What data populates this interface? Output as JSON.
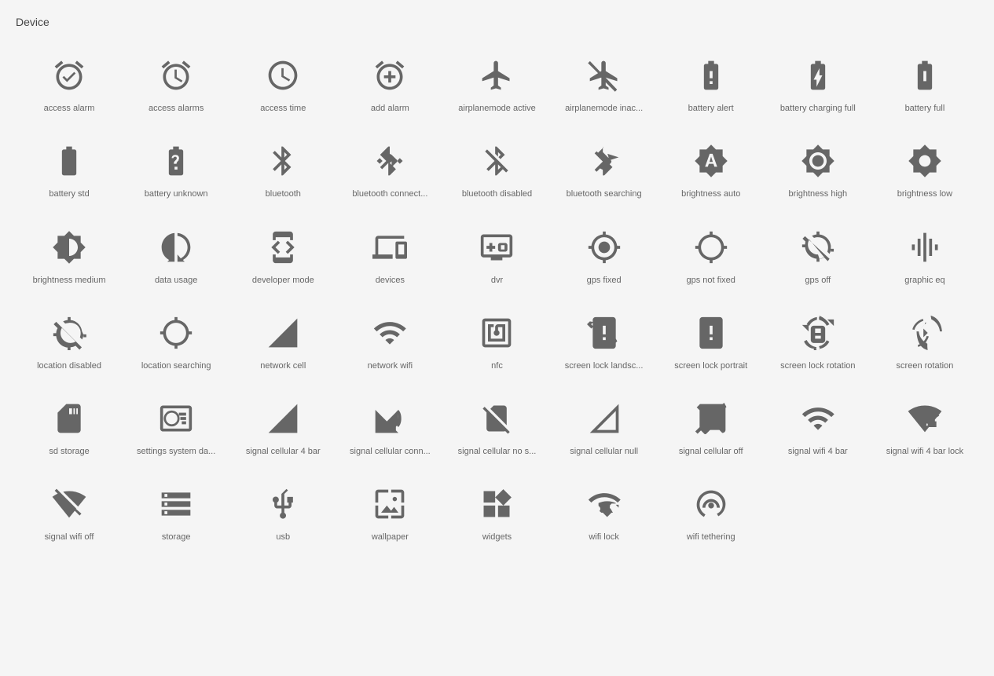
{
  "title": "Device",
  "icons": [
    {
      "name": "access-alarm-icon",
      "label": "access alarm",
      "svg": "alarm1"
    },
    {
      "name": "access-alarms-icon",
      "label": "access alarms",
      "svg": "alarm2"
    },
    {
      "name": "access-time-icon",
      "label": "access time",
      "svg": "clock"
    },
    {
      "name": "add-alarm-icon",
      "label": "add alarm",
      "svg": "addalarm"
    },
    {
      "name": "airplanemode-active-icon",
      "label": "airplanemode active",
      "svg": "airplane"
    },
    {
      "name": "airplanemode-inactive-icon",
      "label": "airplanemode inac...",
      "svg": "airplaneoff"
    },
    {
      "name": "battery-alert-icon",
      "label": "battery alert",
      "svg": "batteryalert"
    },
    {
      "name": "battery-charging-full-icon",
      "label": "battery charging full",
      "svg": "batterychargingfull"
    },
    {
      "name": "battery-full-icon",
      "label": "battery full",
      "svg": "batteryfull"
    },
    {
      "name": "battery-std-icon",
      "label": "battery std",
      "svg": "batterystd"
    },
    {
      "name": "battery-unknown-icon",
      "label": "battery unknown",
      "svg": "batteryunknown"
    },
    {
      "name": "bluetooth-icon",
      "label": "bluetooth",
      "svg": "bluetooth"
    },
    {
      "name": "bluetooth-connected-icon",
      "label": "bluetooth connect...",
      "svg": "bluetoothconnected"
    },
    {
      "name": "bluetooth-disabled-icon",
      "label": "bluetooth disabled",
      "svg": "bluetoothdisabled"
    },
    {
      "name": "bluetooth-searching-icon",
      "label": "bluetooth searching",
      "svg": "bluetoothsearching"
    },
    {
      "name": "brightness-auto-icon",
      "label": "brightness auto",
      "svg": "brightnessauto"
    },
    {
      "name": "brightness-high-icon",
      "label": "brightness high",
      "svg": "brightnesshigh"
    },
    {
      "name": "brightness-low-icon",
      "label": "brightness low",
      "svg": "brightnesslow"
    },
    {
      "name": "brightness-medium-icon",
      "label": "brightness medium",
      "svg": "brightnessmedium"
    },
    {
      "name": "data-usage-icon",
      "label": "data usage",
      "svg": "datausage"
    },
    {
      "name": "developer-mode-icon",
      "label": "developer mode",
      "svg": "developermode"
    },
    {
      "name": "devices-icon",
      "label": "devices",
      "svg": "devices"
    },
    {
      "name": "dvr-icon",
      "label": "dvr",
      "svg": "dvr"
    },
    {
      "name": "gps-fixed-icon",
      "label": "gps fixed",
      "svg": "gpsfixed"
    },
    {
      "name": "gps-not-fixed-icon",
      "label": "gps not fixed",
      "svg": "gpsnotfixed"
    },
    {
      "name": "gps-off-icon",
      "label": "gps off",
      "svg": "gpsoff"
    },
    {
      "name": "graphic-eq-icon",
      "label": "graphic eq",
      "svg": "graphiceq"
    },
    {
      "name": "location-disabled-icon",
      "label": "location disabled",
      "svg": "locationdisabled"
    },
    {
      "name": "location-searching-icon",
      "label": "location searching",
      "svg": "locationsearching"
    },
    {
      "name": "network-cell-icon",
      "label": "network cell",
      "svg": "networkcell"
    },
    {
      "name": "network-wifi-icon",
      "label": "network wifi",
      "svg": "networkwifi"
    },
    {
      "name": "nfc-icon",
      "label": "nfc",
      "svg": "nfc"
    },
    {
      "name": "screen-lock-landscape-icon",
      "label": "screen lock landsc...",
      "svg": "screenlocklandscape"
    },
    {
      "name": "screen-lock-portrait-icon",
      "label": "screen lock portrait",
      "svg": "screenlockportrait"
    },
    {
      "name": "screen-lock-rotation-icon",
      "label": "screen lock rotation",
      "svg": "screenlockrotation"
    },
    {
      "name": "screen-rotation-icon",
      "label": "screen rotation",
      "svg": "screenrotation"
    },
    {
      "name": "sd-storage-icon",
      "label": "sd storage",
      "svg": "sdstorage"
    },
    {
      "name": "settings-system-daydream-icon",
      "label": "settings system da...",
      "svg": "settingssystem"
    },
    {
      "name": "signal-cellular-4bar-icon",
      "label": "signal cellular 4 bar",
      "svg": "signalcellular4bar"
    },
    {
      "name": "signal-cellular-connected-icon",
      "label": "signal cellular conn...",
      "svg": "signalcellularconnected"
    },
    {
      "name": "signal-cellular-no-sim-icon",
      "label": "signal cellular no s...",
      "svg": "signalcellularnosim"
    },
    {
      "name": "signal-cellular-null-icon",
      "label": "signal cellular null",
      "svg": "signalcellularnull"
    },
    {
      "name": "signal-cellular-off-icon",
      "label": "signal cellular off",
      "svg": "signalcellularoff"
    },
    {
      "name": "signal-wifi-4bar-icon",
      "label": "signal wifi 4 bar",
      "svg": "signalwifi4bar"
    },
    {
      "name": "signal-wifi-4bar-lock-icon",
      "label": "signal wifi 4 bar lock",
      "svg": "signalwifi4barlock"
    },
    {
      "name": "signal-wifi-off-icon",
      "label": "signal wifi off",
      "svg": "signalwifioff"
    },
    {
      "name": "storage-icon",
      "label": "storage",
      "svg": "storage"
    },
    {
      "name": "usb-icon",
      "label": "usb",
      "svg": "usb"
    },
    {
      "name": "wallpaper-icon",
      "label": "wallpaper",
      "svg": "wallpaper"
    },
    {
      "name": "widgets-icon",
      "label": "widgets",
      "svg": "widgets"
    },
    {
      "name": "wifi-lock-icon",
      "label": "wifi lock",
      "svg": "wifilock"
    },
    {
      "name": "wifi-tethering-icon",
      "label": "wifi tethering",
      "svg": "wifitethering"
    }
  ]
}
